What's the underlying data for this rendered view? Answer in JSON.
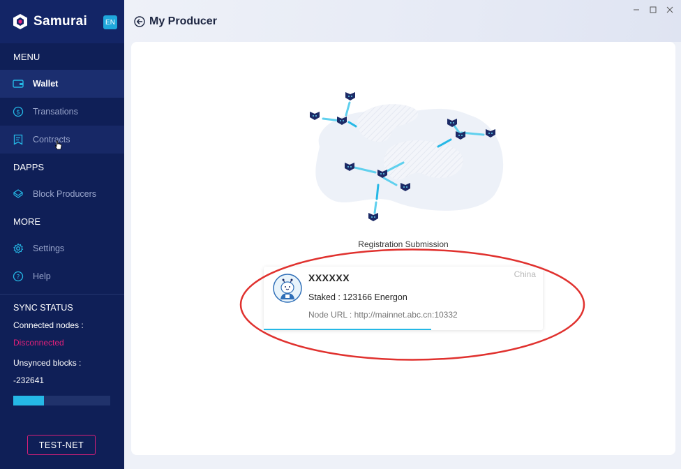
{
  "app": {
    "name": "Samurai",
    "lang": "EN"
  },
  "sidebar": {
    "menu_title": "MENU",
    "menu_items": [
      {
        "label": "Wallet",
        "icon": "wallet-icon",
        "active": true
      },
      {
        "label": "Transations",
        "icon": "dollar-icon"
      },
      {
        "label": "Contracts",
        "icon": "contract-icon"
      }
    ],
    "dapps_title": "DAPPS",
    "dapps_items": [
      {
        "label": "Block Producers",
        "icon": "block-producer-icon"
      }
    ],
    "more_title": "MORE",
    "more_items": [
      {
        "label": "Settings",
        "icon": "gear-icon"
      },
      {
        "label": "Help",
        "icon": "help-icon"
      }
    ]
  },
  "sync": {
    "title": "SYNC STATUS",
    "connected_label": "Connected nodes :",
    "connected_value": "Disconnected",
    "unsynced_label": "Unsynced blocks :",
    "unsynced_value": "-232641",
    "progress_fraction": 0.32,
    "network_button": "TEST-NET"
  },
  "header": {
    "title": "My Producer"
  },
  "main": {
    "registration_text": "Registration Submission",
    "producer": {
      "name": "XXXXXX",
      "country": "China",
      "staked": "Staked : 123166  Energon",
      "node_url": "Node URL : http://mainnet.abc.cn:10332",
      "progress_fraction": 0.6
    }
  },
  "colors": {
    "sidebar_bg": "#0f1f57",
    "accent": "#25b8e6",
    "alert": "#e5217a",
    "annotation": "#e0312e"
  }
}
